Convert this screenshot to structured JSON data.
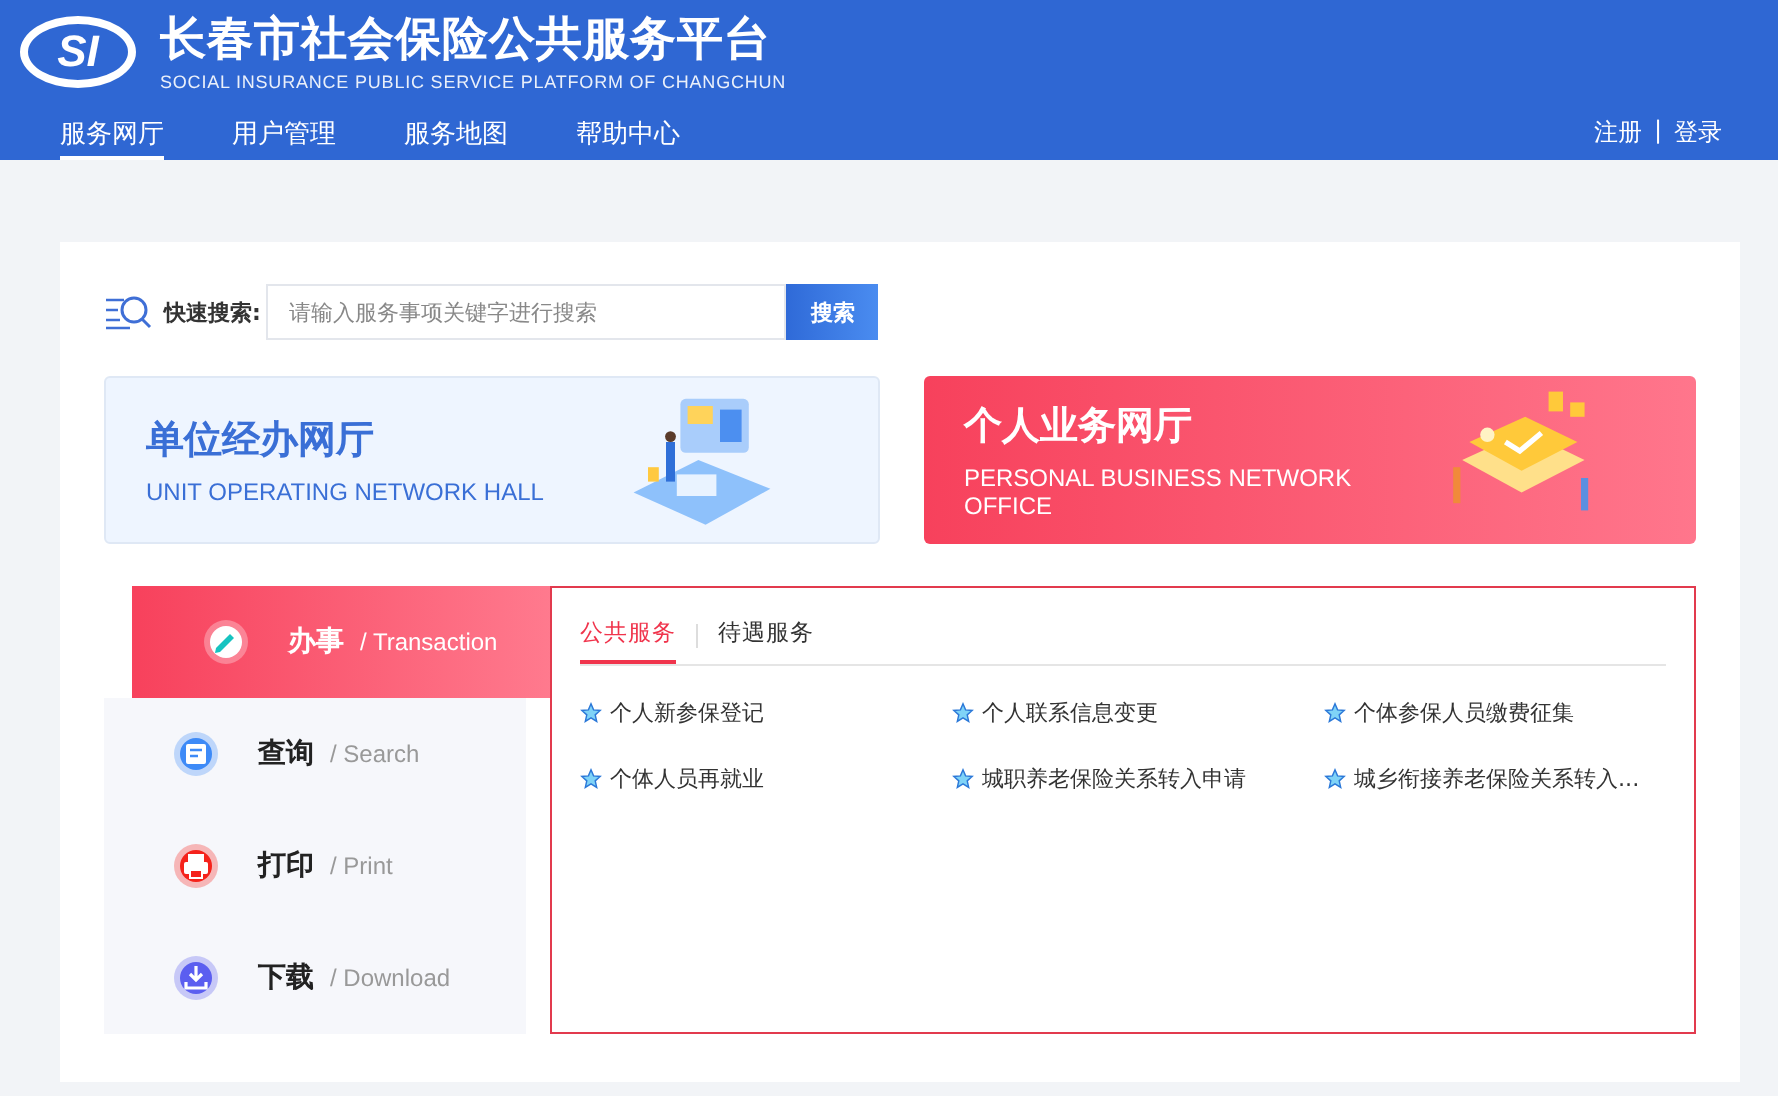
{
  "header": {
    "logo": "SI",
    "title": "长春市社会保险公共服务平台",
    "subtitle": "SOCIAL INSURANCE PUBLIC SERVICE PLATFORM OF CHANGCHUN",
    "nav": [
      {
        "label": "服务网厅",
        "selected": true
      },
      {
        "label": "用户管理",
        "selected": false
      },
      {
        "label": "服务地图",
        "selected": false
      },
      {
        "label": "帮助中心",
        "selected": false
      }
    ],
    "account": [
      "注册",
      "|",
      "登录"
    ]
  },
  "search": {
    "label": "快速搜索:",
    "placeholder": "请输入服务事项关键字进行搜索",
    "button": "搜索"
  },
  "halls": [
    {
      "kind": "unit",
      "title": "单位经办网厅",
      "subtitle": "UNIT OPERATING NETWORK HALL"
    },
    {
      "kind": "personal",
      "title": "个人业务网厅",
      "subtitle": "PERSONAL BUSINESS NETWORK OFFICE"
    }
  ],
  "menu": [
    {
      "kind": "edit",
      "label": "办事",
      "english": "/ Transaction",
      "selected": true,
      "color": "#ffffff"
    },
    {
      "kind": "search",
      "label": "查询",
      "english": "/ Search",
      "selected": false,
      "color": "#3d8af7"
    },
    {
      "kind": "print",
      "label": "打印",
      "english": "/ Print",
      "selected": false,
      "color": "#f5221b"
    },
    {
      "kind": "download",
      "label": "下载",
      "english": "/ Download",
      "selected": false,
      "color": "#5b5ef0"
    }
  ],
  "service_tabs": [
    {
      "label": "公共服务",
      "selected": true
    },
    {
      "label": "待遇服务",
      "selected": false
    }
  ],
  "services": [
    "个人新参保登记",
    "个人联系信息变更",
    "个体参保人员缴费征集",
    "个体人员再就业",
    "城职养老保险关系转入申请",
    "城乡衔接养老保险关系转入..."
  ]
}
